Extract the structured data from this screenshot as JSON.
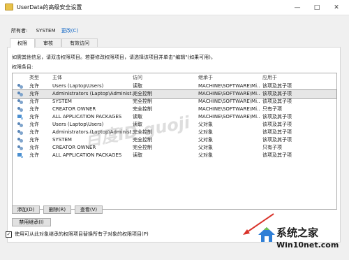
{
  "window": {
    "title": "UserData的高级安全设置",
    "minimize": "—",
    "maximize": "□",
    "close": "✕"
  },
  "owner": {
    "label": "所有者:",
    "value": "SYSTEM",
    "change_link": "更改(C)"
  },
  "tabs": [
    "权限",
    "审核",
    "有效访问"
  ],
  "info_text": "如需其他信息，请双击权限项目。若要修改权限项目，请选择该项目并单击\"编辑\"(如果可用)。",
  "entries_label": "权限条目:",
  "table": {
    "headers": [
      "类型",
      "主体",
      "访问",
      "继承于",
      "应用于"
    ],
    "rows": [
      {
        "icon": "users-icon",
        "type": "允许",
        "principal": "Users (Laptop\\Users)",
        "access": "读取",
        "inherited": "MACHINE\\SOFTWARE\\Mi...",
        "applies": "该项及其子项"
      },
      {
        "icon": "users-icon",
        "type": "允许",
        "principal": "Administrators (Laptop\\Administ...",
        "access": "完全控制",
        "inherited": "MACHINE\\SOFTWARE\\Mi...",
        "applies": "该项及其子项",
        "selected": true
      },
      {
        "icon": "users-icon",
        "type": "允许",
        "principal": "SYSTEM",
        "access": "完全控制",
        "inherited": "MACHINE\\SOFTWARE\\Mi...",
        "applies": "该项及其子项"
      },
      {
        "icon": "users-icon",
        "type": "允许",
        "principal": "CREATOR OWNER",
        "access": "完全控制",
        "inherited": "MACHINE\\SOFTWARE\\Mi...",
        "applies": "只有子项"
      },
      {
        "icon": "package-icon",
        "type": "允许",
        "principal": "ALL APPLICATION PACKAGES",
        "access": "读取",
        "inherited": "MACHINE\\SOFTWARE\\Mi...",
        "applies": "该项及其子项"
      },
      {
        "icon": "users-icon",
        "type": "允许",
        "principal": "Users (Laptop\\Users)",
        "access": "读取",
        "inherited": "父对象",
        "applies": "该项及其子项"
      },
      {
        "icon": "users-icon",
        "type": "允许",
        "principal": "Administrators (Laptop\\Administ...",
        "access": "完全控制",
        "inherited": "父对象",
        "applies": "该项及其子项"
      },
      {
        "icon": "users-icon",
        "type": "允许",
        "principal": "SYSTEM",
        "access": "完全控制",
        "inherited": "父对象",
        "applies": "该项及其子项"
      },
      {
        "icon": "users-icon",
        "type": "允许",
        "principal": "CREATOR OWNER",
        "access": "完全控制",
        "inherited": "父对象",
        "applies": "只有子项"
      },
      {
        "icon": "package-icon",
        "type": "允许",
        "principal": "ALL APPLICATION PACKAGES",
        "access": "读取",
        "inherited": "父对象",
        "applies": "该项及其子项"
      }
    ]
  },
  "buttons": {
    "add": "添加(D)",
    "remove": "删除(R)",
    "view": "查看(V)",
    "disable_inheritance": "禁用继承(I)"
  },
  "replace_checkbox": {
    "checked": true,
    "label": "使用可从此对象继承的权限项目替换所有子对象的权限项目(P)"
  },
  "watermark": "百度ID guoji",
  "branding": {
    "name": "系统之家",
    "url": "Win10net.com"
  },
  "colors": {
    "link": "#0b63c5",
    "selected_row": "#e6e6e6",
    "annotation_arrow": "#d9342b"
  }
}
